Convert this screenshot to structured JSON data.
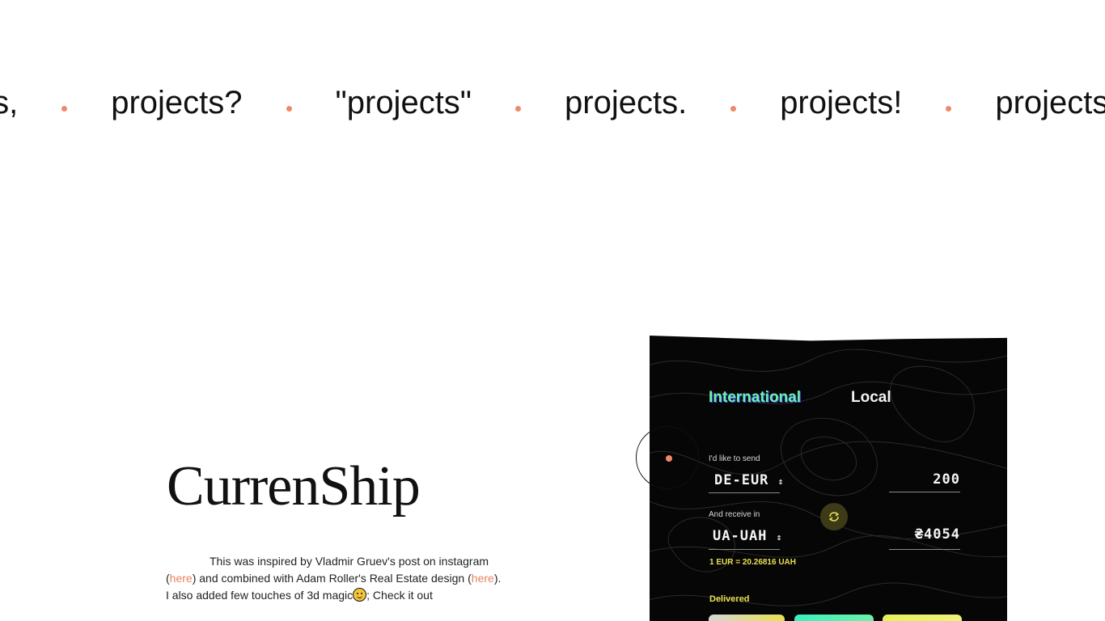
{
  "marquee": {
    "words": [
      "projects,",
      "projects?",
      "\"projects\"",
      "projects.",
      "projects!",
      "projects"
    ],
    "visible_first": "cts,",
    "dot_color": "#f0896a"
  },
  "project": {
    "title": "CurrenShip",
    "description": {
      "part1": "This was inspired by Vladmir Gruev's post on instagram (",
      "link1": "here",
      "part2": ") and combined with Adam Roller's Real Estate design (",
      "link2": "here",
      "part3": "). I also added few touches of 3d magic",
      "part4": "; Check it out"
    },
    "link_color": "#e8825f"
  },
  "cursor": {
    "dot_color": "#f0896a"
  },
  "app_card": {
    "tabs": {
      "international": "International",
      "local": "Local"
    },
    "send": {
      "label": "I'd like to send",
      "currency": "DE-EUR",
      "amount": "200"
    },
    "receive": {
      "label": "And receive in",
      "currency": "UA-UAH",
      "amount": "₴4054"
    },
    "rate": "1 EUR = 20.26816 UAH",
    "delivered_label": "Delivered",
    "accent_colors": {
      "green": "#6ef0a8",
      "yellow": "#e8e050"
    }
  }
}
